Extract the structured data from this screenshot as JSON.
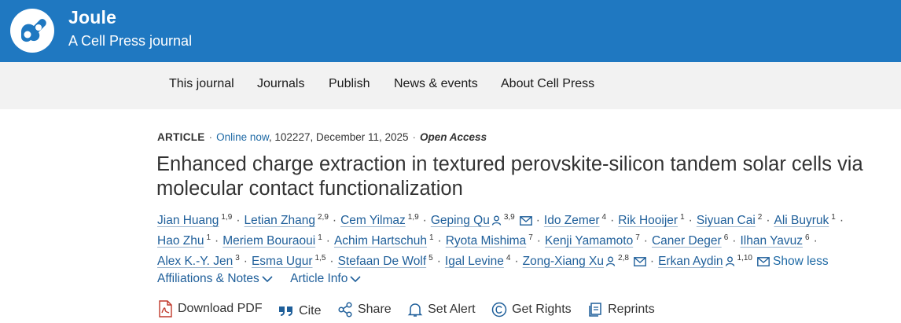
{
  "header": {
    "brand_title": "Joule",
    "brand_subtitle": "A Cell Press journal",
    "logo_icon": "cell-press-logo-icon",
    "bg_color": "#1f78c1"
  },
  "nav": {
    "items": [
      {
        "label": "This journal"
      },
      {
        "label": "Journals"
      },
      {
        "label": "Publish"
      },
      {
        "label": "News & events"
      },
      {
        "label": "About Cell Press"
      }
    ]
  },
  "article": {
    "type": "ARTICLE",
    "online": "Online now",
    "meta_rest": ", 102227, December 11, 2025",
    "access": "Open Access",
    "title": "Enhanced charge extraction in textured perovskite-silicon tandem solar cells via molecular contact functionalization"
  },
  "authors": [
    {
      "name": "Jian Huang",
      "aff": "1,9"
    },
    {
      "name": "Letian Zhang",
      "aff": "2,9"
    },
    {
      "name": "Cem Yilmaz",
      "aff": "1,9"
    },
    {
      "name": "Geping Qu",
      "aff": "3,9",
      "corresponding": true,
      "email": true
    },
    {
      "name": "Ido Zemer",
      "aff": "4"
    },
    {
      "name": "Rik Hooijer",
      "aff": "1"
    },
    {
      "name": "Siyuan Cai",
      "aff": "2"
    },
    {
      "name": "Ali Buyruk",
      "aff": "1"
    },
    {
      "name": "Hao Zhu",
      "aff": "1"
    },
    {
      "name": "Meriem Bouraoui",
      "aff": "1"
    },
    {
      "name": "Achim Hartschuh",
      "aff": "1"
    },
    {
      "name": "Ryota Mishima",
      "aff": "7"
    },
    {
      "name": "Kenji Yamamoto",
      "aff": "7"
    },
    {
      "name": "Caner Deger",
      "aff": "6"
    },
    {
      "name": "Ilhan Yavuz",
      "aff": "6"
    },
    {
      "name": "Alex K.-Y. Jen",
      "aff": "3"
    },
    {
      "name": "Esma Ugur",
      "aff": "1,5"
    },
    {
      "name": "Stefaan De Wolf",
      "aff": "5"
    },
    {
      "name": "Igal Levine",
      "aff": "4"
    },
    {
      "name": "Zong-Xiang Xu",
      "aff": "2,8",
      "corresponding": true,
      "email": true
    },
    {
      "name": "Erkan Aydin",
      "aff": "1,10",
      "corresponding": true,
      "email": true
    }
  ],
  "authors_toggle": "Show less",
  "toggles": {
    "affiliations": "Affiliations & Notes",
    "article_info": "Article Info"
  },
  "actions": [
    {
      "label": "Download PDF",
      "icon": "pdf-icon"
    },
    {
      "label": "Cite",
      "icon": "quote-icon"
    },
    {
      "label": "Share",
      "icon": "share-icon"
    },
    {
      "label": "Set Alert",
      "icon": "bell-icon"
    },
    {
      "label": "Get Rights",
      "icon": "copyright-icon"
    },
    {
      "label": "Reprints",
      "icon": "reprints-icon"
    }
  ]
}
